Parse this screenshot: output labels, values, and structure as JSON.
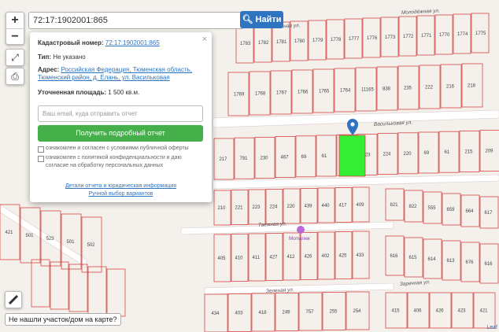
{
  "search": {
    "value": "72:17:1902001:865",
    "find_label": "Найти"
  },
  "controls": {
    "zoom_in": "+",
    "zoom_out": "−"
  },
  "popup": {
    "cadastral_label": "Кадастровый номер:",
    "cadastral_value": "72:17:1902001:865",
    "type_label": "Тип:",
    "type_value": "Не указано",
    "address_label": "Адрес:",
    "address_line1": "Российская Федерация, Тюменская область,",
    "address_line2": "Тюменский район, д. Елань, ул. Васильковая",
    "area_label": "Уточненная площадь:",
    "area_value": "1 500 кв.м.",
    "email_placeholder": "Ваш email, куда отправить отчет",
    "report_button": "Получить подробный отчет",
    "consent1": "ознакомлен и согласен с условиями публичной оферты",
    "consent2": "ознакомлен с политикой конфиденциальности и даю согласие на обработку персональных данных",
    "link_details": "Детали отчета и юридическая информация",
    "link_manual": "Ручной выбор вариантов",
    "close": "×"
  },
  "not_found": "Не нашли участок/дом на карте?",
  "attribution": "Leaf",
  "map": {
    "streets": [
      "Молодёжная ул.",
      "Таежная ул.",
      "Васильковая ул.",
      "Таежная ул.",
      "Заречная ул.",
      "Зеленая ул."
    ],
    "poi": "Мотылек",
    "parcel_color": "#33ee33",
    "parcels": [
      "1783",
      "1782",
      "1781",
      "1780",
      "1779",
      "1778",
      "1777",
      "1776",
      "1773",
      "1772",
      "1771",
      "1770",
      "1774",
      "1775",
      "1769",
      "1768",
      "1767",
      "1766",
      "1765",
      "1764",
      "11165",
      "838",
      "235",
      "222",
      "216",
      "218",
      "217",
      "791",
      "230",
      "467",
      "69",
      "61",
      "221",
      "223",
      "224",
      "220",
      "69",
      "61",
      "215",
      "209",
      "210",
      "221",
      "223",
      "224",
      "220",
      "439",
      "440",
      "417",
      "409",
      "405",
      "410",
      "411",
      "427",
      "412",
      "426",
      "402",
      "425",
      "433",
      "434",
      "403",
      "418",
      "249",
      "757",
      "255",
      "254",
      "821",
      "822",
      "555",
      "659",
      "664",
      "617",
      "616",
      "615",
      "614",
      "613",
      "676",
      "616",
      "415",
      "406",
      "426",
      "423",
      "421",
      "421",
      "501",
      "523",
      "501",
      "502"
    ]
  }
}
